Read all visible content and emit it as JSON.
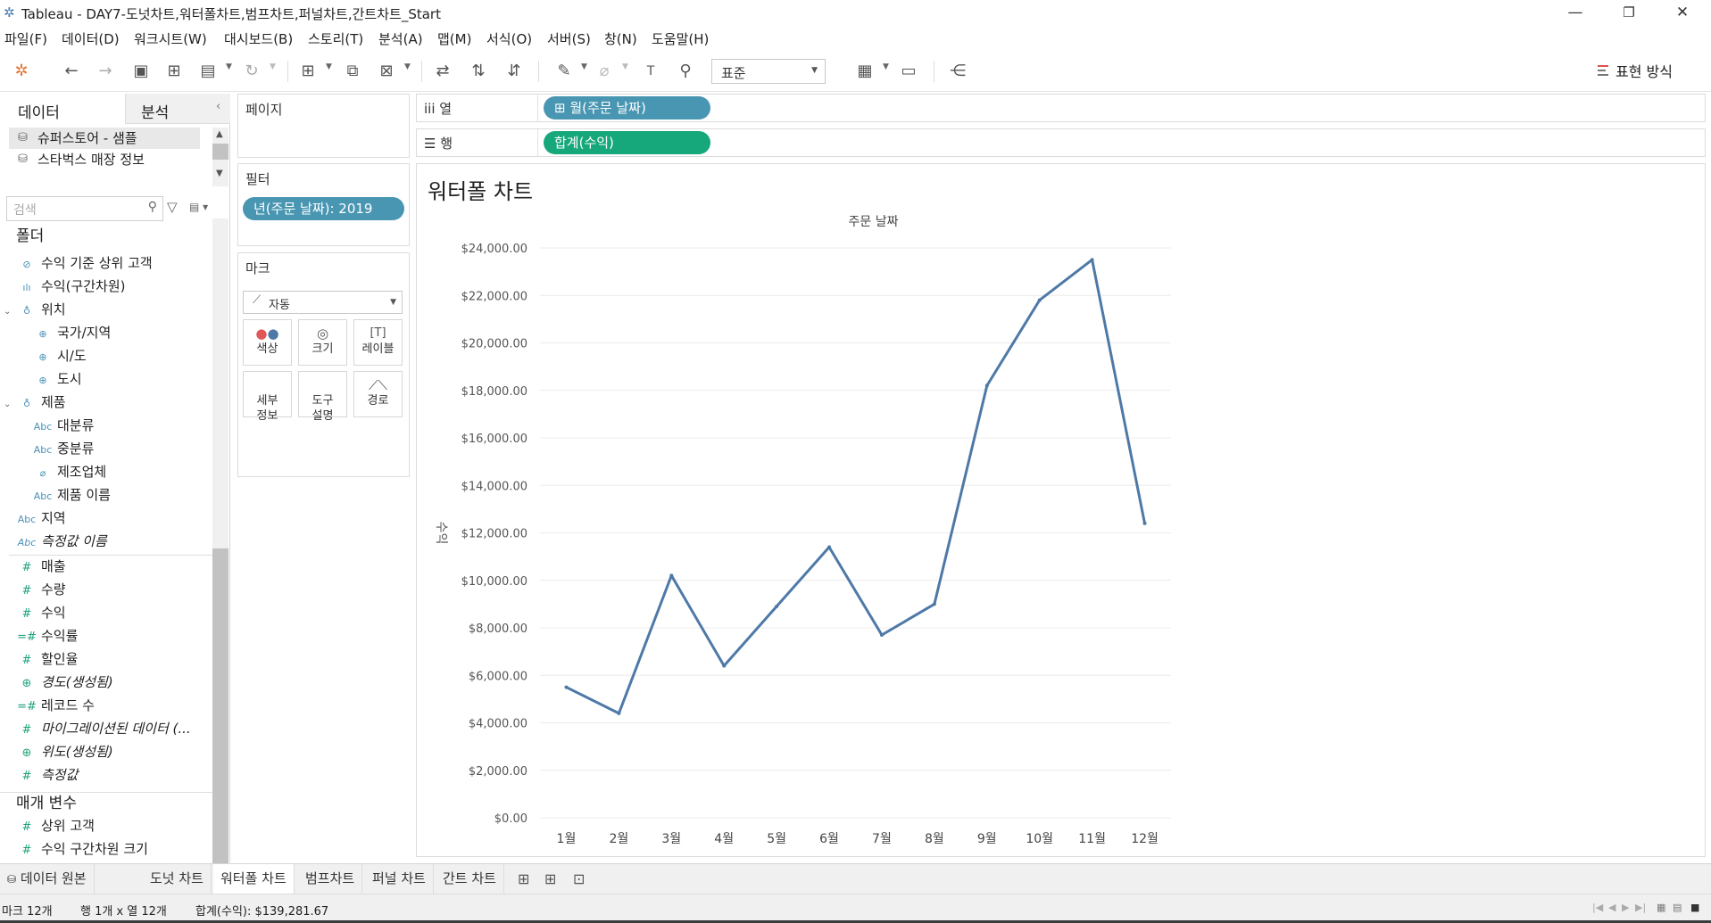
{
  "window": {
    "title": "Tableau - DAY7-도넛차트,워터폴차트,범프차트,퍼널차트,간트차트_Start",
    "minimize": "—",
    "restore": "❐",
    "close": "✕"
  },
  "menu": [
    "파일(F)",
    "데이터(D)",
    "워크시트(W)",
    "대시보드(B)",
    "스토리(T)",
    "분석(A)",
    "맵(M)",
    "서식(O)",
    "서버(S)",
    "창(N)",
    "도움말(H)"
  ],
  "toolbar": {
    "fit_value": "표준",
    "show_me_label": "표현 방식"
  },
  "data_pane": {
    "tab_data": "데이터",
    "tab_analysis": "분석",
    "datasources": [
      "슈퍼스토어 - 샘플",
      "스타벅스 매장 정보"
    ],
    "search_placeholder": "검색",
    "folders_header": "폴더",
    "fields": [
      {
        "label": "수익 기준 상위 고객",
        "icon": "set-icon",
        "glyph": "⊘",
        "indent": 0,
        "type": "dim"
      },
      {
        "label": "수익(구간차원)",
        "icon": "bin-icon",
        "glyph": "ılı",
        "indent": 0,
        "type": "dim"
      },
      {
        "label": "위치",
        "icon": "hierarchy-icon",
        "glyph": "♁",
        "indent": 0,
        "type": "hier"
      },
      {
        "label": "국가/지역",
        "icon": "globe-icon",
        "glyph": "⊕",
        "indent": 1,
        "type": "dim"
      },
      {
        "label": "시/도",
        "icon": "globe-icon",
        "glyph": "⊕",
        "indent": 1,
        "type": "dim"
      },
      {
        "label": "도시",
        "icon": "globe-icon",
        "glyph": "⊕",
        "indent": 1,
        "type": "dim"
      },
      {
        "label": "제품",
        "icon": "hierarchy-icon",
        "glyph": "♁",
        "indent": 0,
        "type": "hier"
      },
      {
        "label": "대분류",
        "icon": "abc-icon",
        "glyph": "Abc",
        "indent": 1,
        "type": "dim"
      },
      {
        "label": "중분류",
        "icon": "abc-icon",
        "glyph": "Abc",
        "indent": 1,
        "type": "dim"
      },
      {
        "label": "제조업체",
        "icon": "paperclip-icon",
        "glyph": "⌀",
        "indent": 1,
        "type": "dim"
      },
      {
        "label": "제품 이름",
        "icon": "abc-icon",
        "glyph": "Abc",
        "indent": 1,
        "type": "dim"
      },
      {
        "label": "지역",
        "icon": "abc-icon",
        "glyph": "Abc",
        "indent": 0,
        "type": "dim"
      },
      {
        "label": "측정값 이름",
        "icon": "abc-icon",
        "glyph": "Abc",
        "indent": 0,
        "type": "dim-it"
      },
      {
        "label": "매출",
        "icon": "measure-icon",
        "glyph": "#",
        "indent": 0,
        "type": "meas"
      },
      {
        "label": "수량",
        "icon": "measure-icon",
        "glyph": "#",
        "indent": 0,
        "type": "meas"
      },
      {
        "label": "수익",
        "icon": "measure-icon",
        "glyph": "#",
        "indent": 0,
        "type": "meas"
      },
      {
        "label": "수익률",
        "icon": "calc-measure-icon",
        "glyph": "=#",
        "indent": 0,
        "type": "meas"
      },
      {
        "label": "할인율",
        "icon": "measure-icon",
        "glyph": "#",
        "indent": 0,
        "type": "meas"
      },
      {
        "label": "경도(생성됨)",
        "icon": "globe-icon",
        "glyph": "⊕",
        "indent": 0,
        "type": "meas-it"
      },
      {
        "label": "레코드 수",
        "icon": "calc-measure-icon",
        "glyph": "=#",
        "indent": 0,
        "type": "meas"
      },
      {
        "label": "마이그레이션된 데이터 (...",
        "icon": "measure-icon",
        "glyph": "#",
        "indent": 0,
        "type": "meas-it"
      },
      {
        "label": "위도(생성됨)",
        "icon": "globe-icon",
        "glyph": "⊕",
        "indent": 0,
        "type": "meas-it"
      },
      {
        "label": "측정값",
        "icon": "measure-icon",
        "glyph": "#",
        "indent": 0,
        "type": "meas-it"
      }
    ],
    "params_header": "매개 변수",
    "params": [
      "상위 고객",
      "수익 구간차원 크기"
    ]
  },
  "cards": {
    "pages_title": "페이지",
    "filters_title": "필터",
    "filter_pill": "년(주문 날짜): 2019",
    "marks_title": "마크",
    "mark_type": "자동",
    "mark_buttons": [
      {
        "label": "색상",
        "icon": "color-icon"
      },
      {
        "label": "크기",
        "icon": "size-icon"
      },
      {
        "label": "레이블",
        "icon": "label-icon"
      },
      {
        "label": "세부\n정보",
        "icon": "detail-icon"
      },
      {
        "label": "도구\n설명",
        "icon": "tooltip-icon"
      },
      {
        "label": "경로",
        "icon": "path-icon"
      }
    ]
  },
  "shelves": {
    "columns_label": "열",
    "columns_pill": "⊞ 월(주문 날짜)",
    "rows_label": "행",
    "rows_pill": "합계(수익)"
  },
  "view": {
    "title": "워터폴 차트"
  },
  "chart_data": {
    "type": "line",
    "title": "워터폴 차트",
    "xlabel": "주문 날짜",
    "ylabel": "수익",
    "categories": [
      "1월",
      "2월",
      "3월",
      "4월",
      "5월",
      "6월",
      "7월",
      "8월",
      "9월",
      "10월",
      "11월",
      "12월"
    ],
    "values": [
      5500,
      4400,
      10200,
      6400,
      8900,
      11400,
      7700,
      9000,
      18200,
      21800,
      23500,
      12400
    ],
    "ylim": [
      0,
      24000
    ],
    "yticks": [
      "$0.00",
      "$2,000.00",
      "$4,000.00",
      "$6,000.00",
      "$8,000.00",
      "$10,000.00",
      "$12,000.00",
      "$14,000.00",
      "$16,000.00",
      "$18,000.00",
      "$20,000.00",
      "$22,000.00",
      "$24,000.00"
    ],
    "line_color": "#4e79a7",
    "grid": true
  },
  "sheet_tabs": [
    "데이터 원본",
    "도넛 차트",
    "워터폴 차트",
    "범프차트",
    "퍼널 차트",
    "간트 차트"
  ],
  "active_sheet": "워터폴 차트",
  "status": {
    "marks": "마크 12개",
    "rows_cols": "행 1개 x 열 12개",
    "sum": "합계(수익): $139,281.67"
  }
}
